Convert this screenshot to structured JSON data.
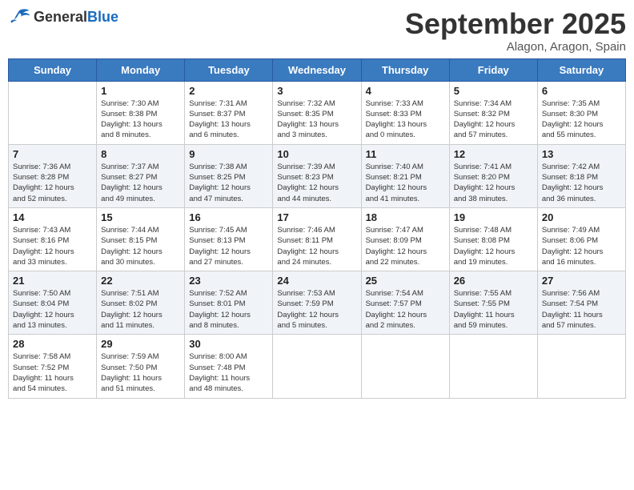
{
  "header": {
    "logo_general": "General",
    "logo_blue": "Blue",
    "month": "September 2025",
    "location": "Alagon, Aragon, Spain"
  },
  "days_of_week": [
    "Sunday",
    "Monday",
    "Tuesday",
    "Wednesday",
    "Thursday",
    "Friday",
    "Saturday"
  ],
  "weeks": [
    [
      {
        "day": "",
        "info": ""
      },
      {
        "day": "1",
        "info": "Sunrise: 7:30 AM\nSunset: 8:38 PM\nDaylight: 13 hours\nand 8 minutes."
      },
      {
        "day": "2",
        "info": "Sunrise: 7:31 AM\nSunset: 8:37 PM\nDaylight: 13 hours\nand 6 minutes."
      },
      {
        "day": "3",
        "info": "Sunrise: 7:32 AM\nSunset: 8:35 PM\nDaylight: 13 hours\nand 3 minutes."
      },
      {
        "day": "4",
        "info": "Sunrise: 7:33 AM\nSunset: 8:33 PM\nDaylight: 13 hours\nand 0 minutes."
      },
      {
        "day": "5",
        "info": "Sunrise: 7:34 AM\nSunset: 8:32 PM\nDaylight: 12 hours\nand 57 minutes."
      },
      {
        "day": "6",
        "info": "Sunrise: 7:35 AM\nSunset: 8:30 PM\nDaylight: 12 hours\nand 55 minutes."
      }
    ],
    [
      {
        "day": "7",
        "info": "Sunrise: 7:36 AM\nSunset: 8:28 PM\nDaylight: 12 hours\nand 52 minutes."
      },
      {
        "day": "8",
        "info": "Sunrise: 7:37 AM\nSunset: 8:27 PM\nDaylight: 12 hours\nand 49 minutes."
      },
      {
        "day": "9",
        "info": "Sunrise: 7:38 AM\nSunset: 8:25 PM\nDaylight: 12 hours\nand 47 minutes."
      },
      {
        "day": "10",
        "info": "Sunrise: 7:39 AM\nSunset: 8:23 PM\nDaylight: 12 hours\nand 44 minutes."
      },
      {
        "day": "11",
        "info": "Sunrise: 7:40 AM\nSunset: 8:21 PM\nDaylight: 12 hours\nand 41 minutes."
      },
      {
        "day": "12",
        "info": "Sunrise: 7:41 AM\nSunset: 8:20 PM\nDaylight: 12 hours\nand 38 minutes."
      },
      {
        "day": "13",
        "info": "Sunrise: 7:42 AM\nSunset: 8:18 PM\nDaylight: 12 hours\nand 36 minutes."
      }
    ],
    [
      {
        "day": "14",
        "info": "Sunrise: 7:43 AM\nSunset: 8:16 PM\nDaylight: 12 hours\nand 33 minutes."
      },
      {
        "day": "15",
        "info": "Sunrise: 7:44 AM\nSunset: 8:15 PM\nDaylight: 12 hours\nand 30 minutes."
      },
      {
        "day": "16",
        "info": "Sunrise: 7:45 AM\nSunset: 8:13 PM\nDaylight: 12 hours\nand 27 minutes."
      },
      {
        "day": "17",
        "info": "Sunrise: 7:46 AM\nSunset: 8:11 PM\nDaylight: 12 hours\nand 24 minutes."
      },
      {
        "day": "18",
        "info": "Sunrise: 7:47 AM\nSunset: 8:09 PM\nDaylight: 12 hours\nand 22 minutes."
      },
      {
        "day": "19",
        "info": "Sunrise: 7:48 AM\nSunset: 8:08 PM\nDaylight: 12 hours\nand 19 minutes."
      },
      {
        "day": "20",
        "info": "Sunrise: 7:49 AM\nSunset: 8:06 PM\nDaylight: 12 hours\nand 16 minutes."
      }
    ],
    [
      {
        "day": "21",
        "info": "Sunrise: 7:50 AM\nSunset: 8:04 PM\nDaylight: 12 hours\nand 13 minutes."
      },
      {
        "day": "22",
        "info": "Sunrise: 7:51 AM\nSunset: 8:02 PM\nDaylight: 12 hours\nand 11 minutes."
      },
      {
        "day": "23",
        "info": "Sunrise: 7:52 AM\nSunset: 8:01 PM\nDaylight: 12 hours\nand 8 minutes."
      },
      {
        "day": "24",
        "info": "Sunrise: 7:53 AM\nSunset: 7:59 PM\nDaylight: 12 hours\nand 5 minutes."
      },
      {
        "day": "25",
        "info": "Sunrise: 7:54 AM\nSunset: 7:57 PM\nDaylight: 12 hours\nand 2 minutes."
      },
      {
        "day": "26",
        "info": "Sunrise: 7:55 AM\nSunset: 7:55 PM\nDaylight: 11 hours\nand 59 minutes."
      },
      {
        "day": "27",
        "info": "Sunrise: 7:56 AM\nSunset: 7:54 PM\nDaylight: 11 hours\nand 57 minutes."
      }
    ],
    [
      {
        "day": "28",
        "info": "Sunrise: 7:58 AM\nSunset: 7:52 PM\nDaylight: 11 hours\nand 54 minutes."
      },
      {
        "day": "29",
        "info": "Sunrise: 7:59 AM\nSunset: 7:50 PM\nDaylight: 11 hours\nand 51 minutes."
      },
      {
        "day": "30",
        "info": "Sunrise: 8:00 AM\nSunset: 7:48 PM\nDaylight: 11 hours\nand 48 minutes."
      },
      {
        "day": "",
        "info": ""
      },
      {
        "day": "",
        "info": ""
      },
      {
        "day": "",
        "info": ""
      },
      {
        "day": "",
        "info": ""
      }
    ]
  ]
}
